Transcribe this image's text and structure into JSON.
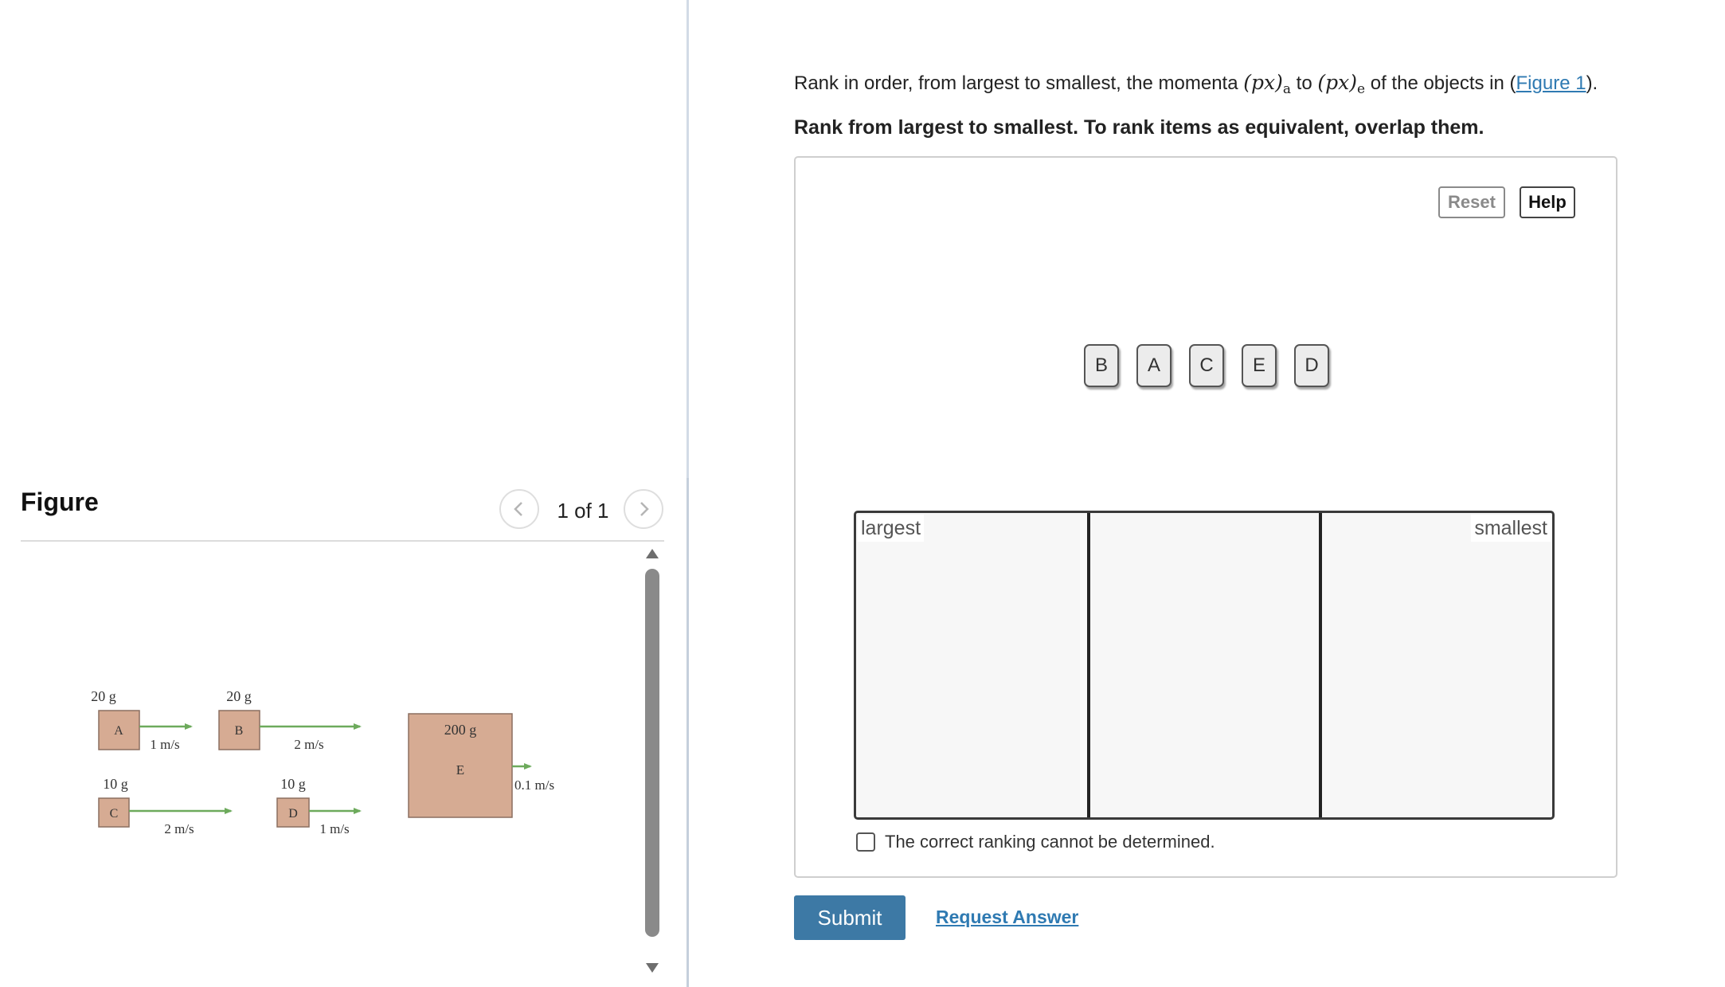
{
  "question": {
    "prefix": "Rank in order, from largest to smallest, the momenta ",
    "math_a": "(p",
    "math_a_var": "x",
    "math_a_close": ")",
    "math_a_sub": "a",
    "middle": " to ",
    "math_e": "(p",
    "math_e_var": "x",
    "math_e_close": ")",
    "math_e_sub": "e",
    "suffix": " of the objects in (",
    "link": "Figure 1",
    "end": ")."
  },
  "instruction": "Rank from largest to smallest. To rank items as equivalent, overlap them.",
  "toolbar": {
    "reset_label": "Reset",
    "help_label": "Help"
  },
  "chips": [
    "B",
    "A",
    "C",
    "E",
    "D"
  ],
  "ranking": {
    "largest_label": "largest",
    "smallest_label": "smallest",
    "bin_count": 3
  },
  "cannot_determine": {
    "label": "The correct ranking cannot be determined.",
    "checked": false
  },
  "actions": {
    "submit_label": "Submit",
    "request_answer_label": "Request Answer"
  },
  "figure_panel": {
    "title": "Figure",
    "page_indicator": "1 of 1"
  },
  "figure": {
    "objects": [
      {
        "id": "A",
        "mass": "20 g",
        "velocity": "1 m/s"
      },
      {
        "id": "B",
        "mass": "20 g",
        "velocity": "2 m/s"
      },
      {
        "id": "C",
        "mass": "10 g",
        "velocity": "2 m/s"
      },
      {
        "id": "D",
        "mass": "10 g",
        "velocity": "1 m/s"
      },
      {
        "id": "E",
        "mass": "200 g",
        "velocity": "0.1 m/s"
      }
    ],
    "colors": {
      "block_fill": "#d6ab93",
      "block_stroke": "#8b6f60",
      "arrow": "#6daa5c"
    }
  },
  "colors": {
    "accent": "#3d79a5",
    "link": "#2f7ab2"
  }
}
